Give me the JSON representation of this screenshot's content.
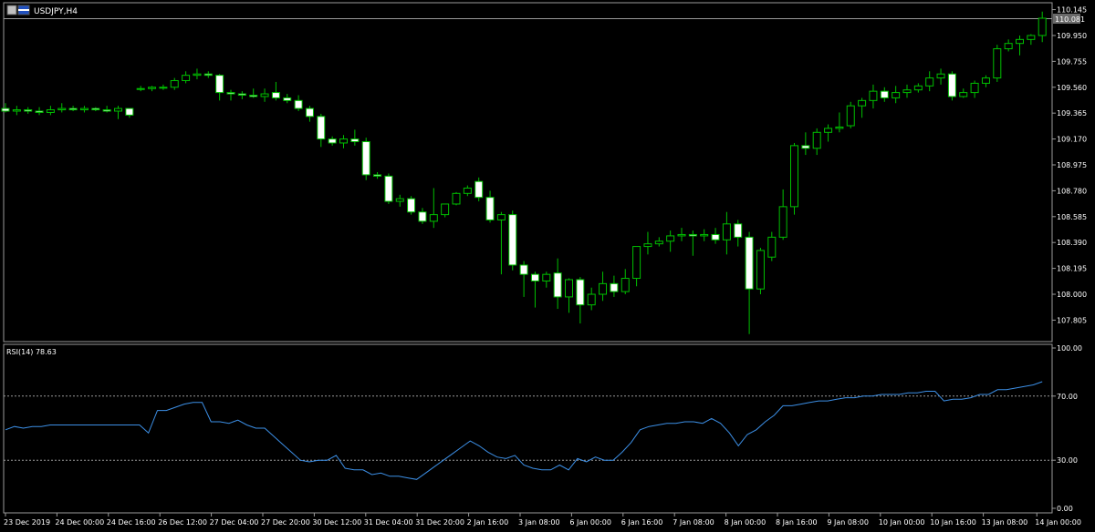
{
  "window": {
    "symbol_title": "USDJPY,H4"
  },
  "rsi": {
    "label": "RSI(14) 78.63",
    "levels": [
      70,
      30
    ],
    "axis": [
      "100.00",
      "70.00",
      "30.00",
      "0.00"
    ]
  },
  "price_axis": [
    "110.145",
    "109.950",
    "109.755",
    "109.560",
    "109.365",
    "109.170",
    "108.975",
    "108.780",
    "108.585",
    "108.390",
    "108.195",
    "108.000",
    "107.805"
  ],
  "current_price": "110.081",
  "time_axis": [
    "23 Dec 2019",
    "24 Dec 00:00",
    "24 Dec 16:00",
    "26 Dec 12:00",
    "27 Dec 04:00",
    "27 Dec 20:00",
    "30 Dec 12:00",
    "31 Dec 04:00",
    "31 Dec 20:00",
    "2 Jan 16:00",
    "3 Jan 08:00",
    "6 Jan 00:00",
    "6 Jan 16:00",
    "7 Jan 08:00",
    "8 Jan 00:00",
    "8 Jan 16:00",
    "9 Jan 08:00",
    "10 Jan 00:00",
    "10 Jan 16:00",
    "13 Jan 08:00",
    "14 Jan 00:00"
  ],
  "colors": {
    "bull_wick": "#00c000",
    "bear_fill": "#ffffff",
    "rsi_line": "#3c8fe6",
    "grid": "#7f7f7f",
    "current_tag": "#7f7f7f"
  },
  "chart_data": [
    {
      "type": "candlestick",
      "symbol": "USDJPY",
      "timeframe": "H4",
      "ylim": [
        107.65,
        110.19
      ],
      "candles": [
        {
          "o": 109.4,
          "h": 109.44,
          "l": 109.37,
          "c": 109.38
        },
        {
          "o": 109.38,
          "h": 109.42,
          "l": 109.35,
          "c": 109.39
        },
        {
          "o": 109.39,
          "h": 109.41,
          "l": 109.36,
          "c": 109.38
        },
        {
          "o": 109.38,
          "h": 109.41,
          "l": 109.35,
          "c": 109.37
        },
        {
          "o": 109.37,
          "h": 109.42,
          "l": 109.35,
          "c": 109.39
        },
        {
          "o": 109.39,
          "h": 109.44,
          "l": 109.37,
          "c": 109.4
        },
        {
          "o": 109.4,
          "h": 109.42,
          "l": 109.38,
          "c": 109.39
        },
        {
          "o": 109.39,
          "h": 109.42,
          "l": 109.37,
          "c": 109.4
        },
        {
          "o": 109.4,
          "h": 109.41,
          "l": 109.38,
          "c": 109.39
        },
        {
          "o": 109.39,
          "h": 109.42,
          "l": 109.37,
          "c": 109.38
        },
        {
          "o": 109.38,
          "h": 109.42,
          "l": 109.32,
          "c": 109.4
        },
        {
          "o": 109.4,
          "h": 109.4,
          "l": 109.33,
          "c": 109.35
        },
        {
          "o": 109.55,
          "h": 109.57,
          "l": 109.53,
          "c": 109.55
        },
        {
          "o": 109.55,
          "h": 109.57,
          "l": 109.53,
          "c": 109.56
        },
        {
          "o": 109.56,
          "h": 109.58,
          "l": 109.54,
          "c": 109.56
        },
        {
          "o": 109.56,
          "h": 109.63,
          "l": 109.54,
          "c": 109.61
        },
        {
          "o": 109.61,
          "h": 109.68,
          "l": 109.59,
          "c": 109.65
        },
        {
          "o": 109.65,
          "h": 109.7,
          "l": 109.62,
          "c": 109.66
        },
        {
          "o": 109.66,
          "h": 109.68,
          "l": 109.63,
          "c": 109.65
        },
        {
          "o": 109.65,
          "h": 109.66,
          "l": 109.46,
          "c": 109.52
        },
        {
          "o": 109.52,
          "h": 109.54,
          "l": 109.46,
          "c": 109.51
        },
        {
          "o": 109.51,
          "h": 109.53,
          "l": 109.47,
          "c": 109.5
        },
        {
          "o": 109.5,
          "h": 109.55,
          "l": 109.48,
          "c": 109.49
        },
        {
          "o": 109.49,
          "h": 109.55,
          "l": 109.45,
          "c": 109.51
        },
        {
          "o": 109.52,
          "h": 109.6,
          "l": 109.46,
          "c": 109.48
        },
        {
          "o": 109.48,
          "h": 109.51,
          "l": 109.44,
          "c": 109.46
        },
        {
          "o": 109.46,
          "h": 109.5,
          "l": 109.38,
          "c": 109.4
        },
        {
          "o": 109.4,
          "h": 109.42,
          "l": 109.3,
          "c": 109.34
        },
        {
          "o": 109.34,
          "h": 109.36,
          "l": 109.11,
          "c": 109.17
        },
        {
          "o": 109.17,
          "h": 109.19,
          "l": 109.12,
          "c": 109.14
        },
        {
          "o": 109.14,
          "h": 109.2,
          "l": 109.1,
          "c": 109.17
        },
        {
          "o": 109.17,
          "h": 109.24,
          "l": 109.12,
          "c": 109.15
        },
        {
          "o": 109.15,
          "h": 109.18,
          "l": 108.86,
          "c": 108.9
        },
        {
          "o": 108.9,
          "h": 108.92,
          "l": 108.87,
          "c": 108.89
        },
        {
          "o": 108.89,
          "h": 108.91,
          "l": 108.68,
          "c": 108.7
        },
        {
          "o": 108.7,
          "h": 108.75,
          "l": 108.66,
          "c": 108.72
        },
        {
          "o": 108.72,
          "h": 108.74,
          "l": 108.6,
          "c": 108.62
        },
        {
          "o": 108.62,
          "h": 108.65,
          "l": 108.53,
          "c": 108.55
        },
        {
          "o": 108.55,
          "h": 108.8,
          "l": 108.5,
          "c": 108.6
        },
        {
          "o": 108.6,
          "h": 108.67,
          "l": 108.58,
          "c": 108.68
        },
        {
          "o": 108.68,
          "h": 108.77,
          "l": 108.67,
          "c": 108.76
        },
        {
          "o": 108.76,
          "h": 108.82,
          "l": 108.74,
          "c": 108.8
        },
        {
          "o": 108.85,
          "h": 108.88,
          "l": 108.7,
          "c": 108.73
        },
        {
          "o": 108.73,
          "h": 108.78,
          "l": 108.54,
          "c": 108.56
        },
        {
          "o": 108.56,
          "h": 108.62,
          "l": 108.15,
          "c": 108.6
        },
        {
          "o": 108.6,
          "h": 108.63,
          "l": 108.18,
          "c": 108.22
        },
        {
          "o": 108.22,
          "h": 108.25,
          "l": 107.98,
          "c": 108.15
        },
        {
          "o": 108.15,
          "h": 108.17,
          "l": 107.9,
          "c": 108.1
        },
        {
          "o": 108.1,
          "h": 108.17,
          "l": 108.05,
          "c": 108.15
        },
        {
          "o": 108.16,
          "h": 108.27,
          "l": 107.89,
          "c": 107.98
        },
        {
          "o": 107.98,
          "h": 108.12,
          "l": 107.86,
          "c": 108.11
        },
        {
          "o": 108.11,
          "h": 108.13,
          "l": 107.78,
          "c": 107.92
        },
        {
          "o": 107.92,
          "h": 108.05,
          "l": 107.88,
          "c": 108.0
        },
        {
          "o": 108.0,
          "h": 108.17,
          "l": 107.95,
          "c": 108.08
        },
        {
          "o": 108.08,
          "h": 108.14,
          "l": 107.98,
          "c": 108.02
        },
        {
          "o": 108.02,
          "h": 108.19,
          "l": 108.0,
          "c": 108.12
        },
        {
          "o": 108.12,
          "h": 108.3,
          "l": 108.06,
          "c": 108.36
        },
        {
          "o": 108.36,
          "h": 108.47,
          "l": 108.3,
          "c": 108.38
        },
        {
          "o": 108.38,
          "h": 108.43,
          "l": 108.36,
          "c": 108.4
        },
        {
          "o": 108.4,
          "h": 108.48,
          "l": 108.32,
          "c": 108.44
        },
        {
          "o": 108.44,
          "h": 108.5,
          "l": 108.4,
          "c": 108.45
        },
        {
          "o": 108.45,
          "h": 108.48,
          "l": 108.29,
          "c": 108.44
        },
        {
          "o": 108.44,
          "h": 108.49,
          "l": 108.4,
          "c": 108.45
        },
        {
          "o": 108.45,
          "h": 108.5,
          "l": 108.38,
          "c": 108.41
        },
        {
          "o": 108.41,
          "h": 108.62,
          "l": 108.3,
          "c": 108.53
        },
        {
          "o": 108.53,
          "h": 108.56,
          "l": 108.36,
          "c": 108.43
        },
        {
          "o": 108.43,
          "h": 108.47,
          "l": 107.7,
          "c": 108.04
        },
        {
          "o": 108.04,
          "h": 108.35,
          "l": 108.0,
          "c": 108.33
        },
        {
          "o": 108.28,
          "h": 108.47,
          "l": 108.25,
          "c": 108.43
        },
        {
          "o": 108.43,
          "h": 108.79,
          "l": 108.41,
          "c": 108.66
        },
        {
          "o": 108.66,
          "h": 109.14,
          "l": 108.6,
          "c": 109.12
        },
        {
          "o": 109.12,
          "h": 109.22,
          "l": 109.05,
          "c": 109.1
        },
        {
          "o": 109.1,
          "h": 109.25,
          "l": 109.05,
          "c": 109.22
        },
        {
          "o": 109.22,
          "h": 109.28,
          "l": 109.15,
          "c": 109.25
        },
        {
          "o": 109.25,
          "h": 109.37,
          "l": 109.22,
          "c": 109.26
        },
        {
          "o": 109.27,
          "h": 109.45,
          "l": 109.25,
          "c": 109.42
        },
        {
          "o": 109.42,
          "h": 109.48,
          "l": 109.33,
          "c": 109.46
        },
        {
          "o": 109.46,
          "h": 109.58,
          "l": 109.4,
          "c": 109.53
        },
        {
          "o": 109.53,
          "h": 109.56,
          "l": 109.45,
          "c": 109.48
        },
        {
          "o": 109.48,
          "h": 109.57,
          "l": 109.44,
          "c": 109.52
        },
        {
          "o": 109.52,
          "h": 109.58,
          "l": 109.48,
          "c": 109.54
        },
        {
          "o": 109.54,
          "h": 109.59,
          "l": 109.52,
          "c": 109.57
        },
        {
          "o": 109.57,
          "h": 109.68,
          "l": 109.53,
          "c": 109.63
        },
        {
          "o": 109.63,
          "h": 109.7,
          "l": 109.58,
          "c": 109.66
        },
        {
          "o": 109.66,
          "h": 109.68,
          "l": 109.46,
          "c": 109.49
        },
        {
          "o": 109.49,
          "h": 109.55,
          "l": 109.48,
          "c": 109.52
        },
        {
          "o": 109.52,
          "h": 109.61,
          "l": 109.48,
          "c": 109.59
        },
        {
          "o": 109.59,
          "h": 109.65,
          "l": 109.56,
          "c": 109.63
        },
        {
          "o": 109.63,
          "h": 109.88,
          "l": 109.6,
          "c": 109.85
        },
        {
          "o": 109.85,
          "h": 109.92,
          "l": 109.83,
          "c": 109.89
        },
        {
          "o": 109.89,
          "h": 109.95,
          "l": 109.8,
          "c": 109.92
        },
        {
          "o": 109.92,
          "h": 109.96,
          "l": 109.88,
          "c": 109.95
        },
        {
          "o": 109.95,
          "h": 110.13,
          "l": 109.9,
          "c": 110.08
        }
      ]
    },
    {
      "type": "line",
      "name": "RSI(14)",
      "ylim": [
        0,
        100
      ],
      "values": [
        49,
        51,
        50,
        51,
        51,
        52,
        52,
        52,
        52,
        52,
        52,
        52,
        52,
        52,
        52,
        52,
        47,
        61,
        61,
        63,
        65,
        66,
        66,
        54,
        54,
        53,
        55,
        52,
        50,
        50,
        45,
        40,
        35,
        30,
        29,
        30,
        30,
        33,
        25,
        24,
        24,
        21,
        22,
        20,
        20,
        19,
        18,
        22,
        26,
        30,
        34,
        38,
        42,
        39,
        35,
        32,
        31,
        33,
        27,
        25,
        24,
        24,
        27,
        24,
        31,
        29,
        32,
        30,
        30,
        35,
        41,
        49,
        51,
        52,
        53,
        53,
        54,
        54,
        53,
        56,
        53,
        47,
        39,
        46,
        49,
        54,
        58,
        64,
        64,
        65,
        66,
        67,
        67,
        68,
        69,
        69,
        70,
        70,
        71,
        71,
        71,
        72,
        72,
        73,
        73,
        67,
        68,
        68,
        69,
        71,
        71,
        74,
        74,
        75,
        76,
        77,
        79
      ]
    }
  ]
}
